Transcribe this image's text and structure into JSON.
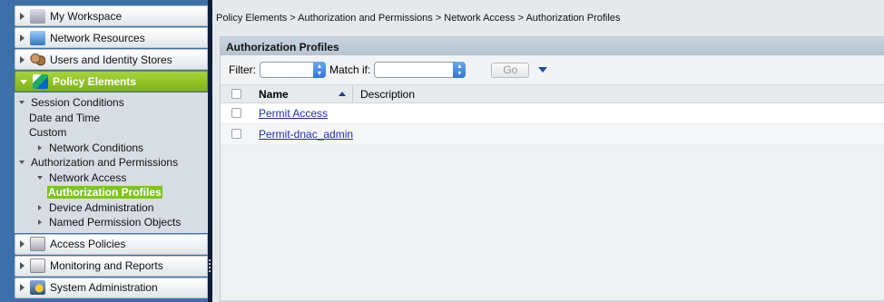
{
  "sidebar": {
    "drawers_top": [
      {
        "label": "My Workspace",
        "icon": "workspace-icon"
      },
      {
        "label": "Network Resources",
        "icon": "network-resources-icon"
      },
      {
        "label": "Users and Identity Stores",
        "icon": "users-icon"
      }
    ],
    "active_drawer": {
      "label": "Policy Elements",
      "icon": "policy-elements-icon"
    },
    "tree": {
      "session_conditions": "Session Conditions",
      "date_and_time": "Date and Time",
      "custom": "Custom",
      "network_conditions": "Network Conditions",
      "authorization_and_permissions": "Authorization and Permissions",
      "network_access": "Network Access",
      "authorization_profiles": "Authorization Profiles",
      "device_administration": "Device Administration",
      "named_permission_objects": "Named Permission Objects"
    },
    "drawers_bottom": [
      {
        "label": "Access Policies",
        "icon": "access-policies-icon"
      },
      {
        "label": "Monitoring and Reports",
        "icon": "monitoring-reports-icon"
      },
      {
        "label": "System Administration",
        "icon": "system-administration-icon"
      }
    ]
  },
  "breadcrumb": "Policy Elements > Authorization and Permissions  > Network Access > Authorization Profiles",
  "panel": {
    "title": "Authorization Profiles",
    "filter_label": "Filter:",
    "match_label": "Match if:",
    "go_label": "Go",
    "columns": {
      "name": "Name",
      "description": "Description"
    },
    "rows": [
      {
        "name": "Permit Access",
        "description": ""
      },
      {
        "name": "Permit-dnac_admin",
        "description": ""
      }
    ]
  },
  "colors": {
    "active_drawer": "#8cc425",
    "sidebar_bg": "#3d6fa8",
    "link": "#1e2fa8"
  }
}
